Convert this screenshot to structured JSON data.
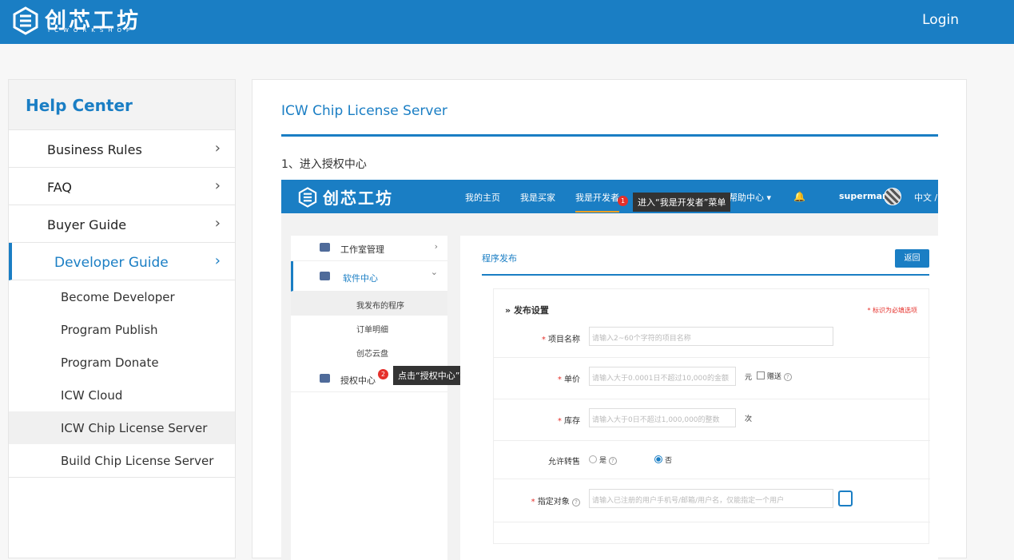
{
  "header": {
    "logo_text": "创芯工坊",
    "logo_sub": "ICWORKSHOP",
    "login_label": "Login"
  },
  "sidebar": {
    "title": "Help Center",
    "items": [
      {
        "label": "Business Rules"
      },
      {
        "label": "FAQ"
      },
      {
        "label": "Buyer Guide"
      },
      {
        "label": "Developer Guide"
      }
    ],
    "sub_items": [
      {
        "label": "Become Developer"
      },
      {
        "label": "Program Publish"
      },
      {
        "label": "Program Donate"
      },
      {
        "label": "ICW Cloud"
      },
      {
        "label": "ICW Chip License Server"
      },
      {
        "label": "Build Chip License Server"
      }
    ],
    "chevron": "›"
  },
  "main": {
    "title": "ICW Chip License Server",
    "step1": "1、进入授权中心"
  },
  "screenshot": {
    "logo_text": "创芯工坊",
    "nav": [
      "我的主页",
      "我是买家",
      "我是开发者",
      "帮助中心 ▾"
    ],
    "bell": "🔔",
    "user": "superman",
    "lang": "中文 /",
    "tip1": {
      "badge": "1",
      "text": "进入“我是开发者”菜单"
    },
    "tip2": {
      "badge": "2",
      "text": "点击“授权中心”进入授权中心"
    },
    "side": {
      "workbench": "工作室管理",
      "software_center": "软件中心",
      "my_programs": "我发布的程序",
      "order_detail": "订单明细",
      "cloud": "创芯云盘",
      "license_center": "授权中心"
    },
    "form": {
      "tab": "程序发布",
      "back": "返回",
      "section": "发布设置",
      "required_note": "* 标识为必填选项",
      "project_name_label": "项目名称",
      "project_name_placeholder": "请输入2~60个字符的项目名称",
      "price_label": "单价",
      "price_placeholder": "请输入大于0.0001日不超过10,000的金额",
      "price_unit": "元",
      "gift_label": "赠送",
      "stock_label": "库存",
      "stock_placeholder": "请输入大于0日不超过1,000,000的整数",
      "stock_unit": "次",
      "resell_label": "允许转售",
      "yes": "是",
      "no": "否",
      "target_label": "指定对象",
      "target_placeholder": "请输入已注册的用户手机号/邮箱/用户名，仅能指定一个用户",
      "qmark": "?"
    }
  }
}
